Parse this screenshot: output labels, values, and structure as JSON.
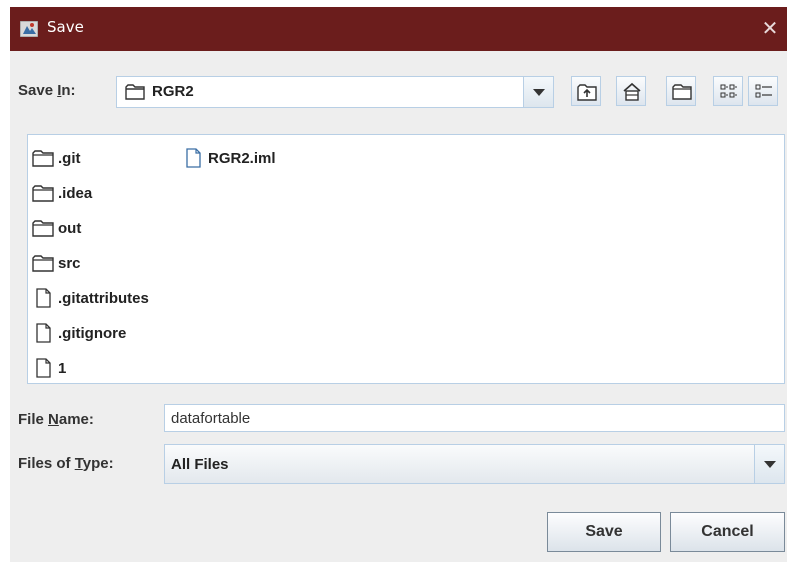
{
  "window": {
    "title": "Save",
    "close_symbol": "✕"
  },
  "save_in": {
    "label_pre": "Save ",
    "label_mnemonic": "I",
    "label_post": "n:",
    "value": "RGR2",
    "icon": "folder-icon"
  },
  "toolbar": [
    {
      "name": "up-one-level-button",
      "icon": "folder-up-icon"
    },
    {
      "name": "home-button",
      "icon": "home-icon"
    },
    {
      "name": "new-folder-button",
      "icon": "new-folder-icon"
    },
    {
      "name": "list-view-button",
      "icon": "list-view-icon"
    },
    {
      "name": "details-view-button",
      "icon": "details-view-icon"
    }
  ],
  "files": [
    {
      "name": ".git",
      "type": "folder"
    },
    {
      "name": ".idea",
      "type": "folder"
    },
    {
      "name": "out",
      "type": "folder"
    },
    {
      "name": "src",
      "type": "folder"
    },
    {
      "name": ".gitattributes",
      "type": "file"
    },
    {
      "name": ".gitignore",
      "type": "file"
    },
    {
      "name": "1",
      "type": "file"
    },
    {
      "name": "RGR2.iml",
      "type": "file"
    }
  ],
  "file_name": {
    "label_pre": "File ",
    "label_mnemonic": "N",
    "label_post": "ame:",
    "value": "datafortable"
  },
  "file_type": {
    "label_pre": "Files of ",
    "label_mnemonic": "T",
    "label_post": "ype:",
    "value": "All Files"
  },
  "buttons": {
    "save": "Save",
    "cancel": "Cancel"
  },
  "colors": {
    "titlebar": "#6b1d1c",
    "dialog_bg": "#eeeeee",
    "border": "#b8cfe5"
  }
}
